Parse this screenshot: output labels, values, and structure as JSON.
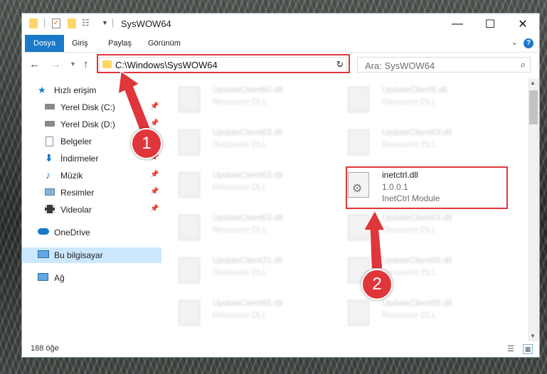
{
  "window": {
    "title": "SysWOW64",
    "controls": {
      "minimize": "—",
      "maximize": "☐",
      "close": "✕"
    }
  },
  "ribbon": {
    "tabs": [
      "Dosya",
      "Giriş",
      "Paylaş",
      "Görünüm"
    ],
    "help": "?"
  },
  "nav": {
    "address": "C:\\Windows\\SysWOW64",
    "search_placeholder": "Ara: SysWOW64"
  },
  "sidebar": {
    "items": [
      {
        "label": "Hızlı erişim",
        "icon": "star-icon",
        "pinned": false
      },
      {
        "label": "Yerel Disk (C:)",
        "icon": "drive-icon",
        "pinned": true
      },
      {
        "label": "Yerel Disk (D:)",
        "icon": "drive-icon",
        "pinned": true
      },
      {
        "label": "Belgeler",
        "icon": "documents-icon",
        "pinned": true
      },
      {
        "label": "İndirmeler",
        "icon": "download-icon",
        "pinned": true
      },
      {
        "label": "Müzik",
        "icon": "music-icon",
        "pinned": true
      },
      {
        "label": "Resimler",
        "icon": "pictures-icon",
        "pinned": true
      },
      {
        "label": "Videolar",
        "icon": "videos-icon",
        "pinned": true
      },
      {
        "label": "OneDrive",
        "icon": "cloud-icon",
        "pinned": false
      },
      {
        "label": "Bu bilgisayar",
        "icon": "computer-icon",
        "pinned": false
      },
      {
        "label": "Ağ",
        "icon": "network-icon",
        "pinned": false
      }
    ]
  },
  "files": [
    {
      "name": "UpdateClient65.dll",
      "desc": "Resource DLL"
    },
    {
      "name": "UpdateClient5.dll",
      "desc": "Resource DLL"
    },
    {
      "name": "UpdateClient63.dll",
      "desc": "Resource DLL"
    },
    {
      "name": "UpdateClient63.dll",
      "desc": "Resource DLL"
    },
    {
      "name": "UpdateClient63.dll",
      "desc": "Resource DLL"
    },
    {
      "name": "UpdateClient63.dll",
      "desc": "Resource DLL"
    },
    {
      "name": "UpdateClient21.dll",
      "desc": "Resource DLL"
    },
    {
      "name": "UpdateClient65.dll",
      "desc": "Resource DLL"
    },
    {
      "name": "UpdateClient65.dll",
      "desc": "Resource DLL"
    },
    {
      "name": "UpdateClient65.dll",
      "desc": "Resource DLL"
    }
  ],
  "highlighted_file": {
    "name": "inetctrl.dll",
    "version": "1.0.0.1",
    "desc": "InetCtrl Module"
  },
  "status": {
    "count": "188 öğe"
  },
  "callouts": [
    "1",
    "2"
  ],
  "colors": {
    "accent": "#1979ca",
    "highlight": "#e0353a",
    "selected": "#cce8ff"
  }
}
